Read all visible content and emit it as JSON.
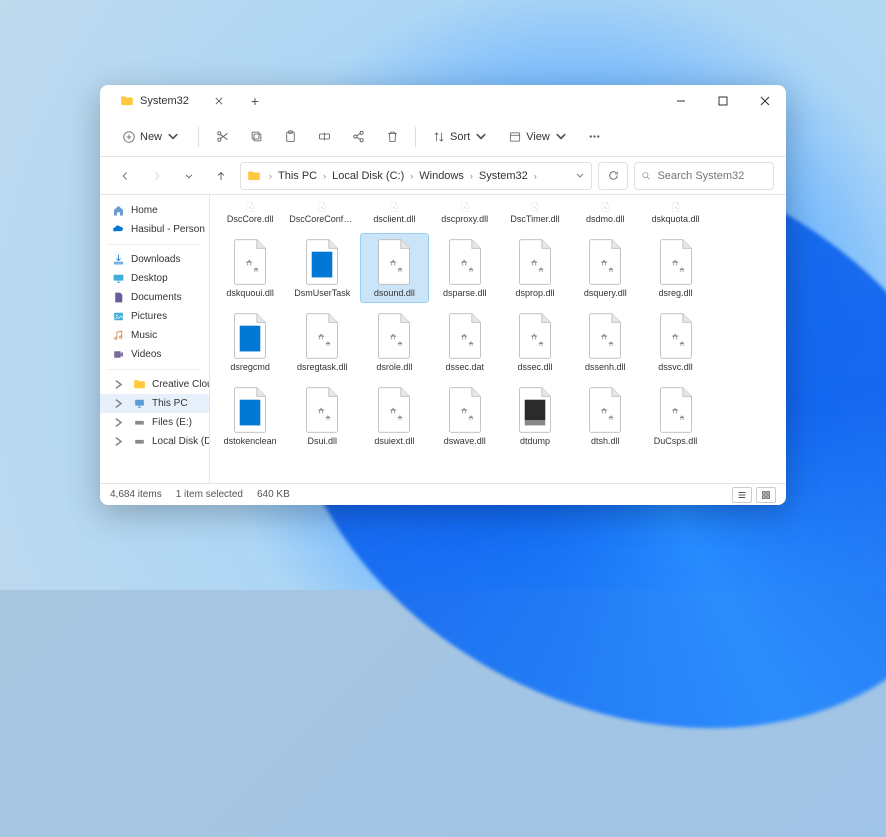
{
  "tab": {
    "title": "System32"
  },
  "toolbar": {
    "new_label": "New",
    "sort_label": "Sort",
    "view_label": "View"
  },
  "breadcrumbs": [
    "This PC",
    "Local Disk (C:)",
    "Windows",
    "System32"
  ],
  "search": {
    "placeholder": "Search System32"
  },
  "sidebar": {
    "home": "Home",
    "onedrive": "Hasibul - Person",
    "downloads": "Downloads",
    "desktop": "Desktop",
    "documents": "Documents",
    "pictures": "Pictures",
    "music": "Music",
    "videos": "Videos",
    "creativecloud": "Creative Cloud F",
    "thispc": "This PC",
    "filese": "Files (E:)",
    "localdiskd": "Local Disk (D:)"
  },
  "files": [
    {
      "name": "DscCore.dll",
      "icon": "dll",
      "trunc": true
    },
    {
      "name": "DscCoreConfProv.dll",
      "icon": "dll",
      "trunc": true
    },
    {
      "name": "dsclient.dll",
      "icon": "dll",
      "trunc": true
    },
    {
      "name": "dscproxy.dll",
      "icon": "dll",
      "trunc": true
    },
    {
      "name": "DscTimer.dll",
      "icon": "dll",
      "trunc": true
    },
    {
      "name": "dsdmo.dll",
      "icon": "dll",
      "trunc": true
    },
    {
      "name": "dskquota.dll",
      "icon": "dll",
      "trunc": true
    },
    {
      "name": "",
      "icon": "spacer",
      "trunc": true
    },
    {
      "name": "dskquoui.dll",
      "icon": "dll"
    },
    {
      "name": "DsmUserTask",
      "icon": "exe"
    },
    {
      "name": "dsound.dll",
      "icon": "dll",
      "selected": true
    },
    {
      "name": "dsparse.dll",
      "icon": "dll"
    },
    {
      "name": "dsprop.dll",
      "icon": "dll"
    },
    {
      "name": "dsquery.dll",
      "icon": "dll"
    },
    {
      "name": "dsreg.dll",
      "icon": "dll"
    },
    {
      "name": "",
      "icon": "spacer"
    },
    {
      "name": "dsregcmd",
      "icon": "exe"
    },
    {
      "name": "dsregtask.dll",
      "icon": "dll"
    },
    {
      "name": "dsrole.dll",
      "icon": "dll"
    },
    {
      "name": "dssec.dat",
      "icon": "dat"
    },
    {
      "name": "dssec.dll",
      "icon": "dll"
    },
    {
      "name": "dssenh.dll",
      "icon": "dll"
    },
    {
      "name": "dssvc.dll",
      "icon": "dll"
    },
    {
      "name": "",
      "icon": "spacer"
    },
    {
      "name": "dstokenclean",
      "icon": "exe"
    },
    {
      "name": "Dsui.dll",
      "icon": "dll"
    },
    {
      "name": "dsuiext.dll",
      "icon": "dll"
    },
    {
      "name": "dswave.dll",
      "icon": "dll"
    },
    {
      "name": "dtdump",
      "icon": "exe-dark"
    },
    {
      "name": "dtsh.dll",
      "icon": "dll"
    },
    {
      "name": "DuCsps.dll",
      "icon": "dll"
    }
  ],
  "status": {
    "count": "4,684 items",
    "selection": "1 item selected",
    "size": "640 KB"
  }
}
